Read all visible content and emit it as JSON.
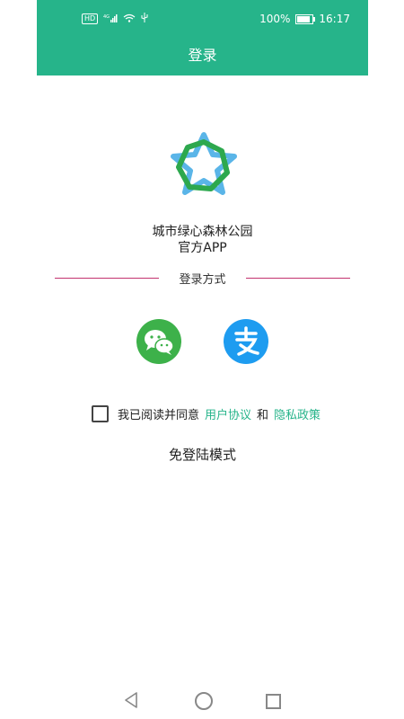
{
  "status_bar": {
    "hd_label": "HD",
    "network": "4G",
    "battery_pct": "100%",
    "time": "16:17"
  },
  "header": {
    "title": "登录",
    "color": "#26b48a"
  },
  "app": {
    "name_line1": "城市绿心森林公园",
    "name_line2": "官方APP"
  },
  "login": {
    "divider_text": "登录方式",
    "methods": [
      "wechat-icon",
      "alipay-icon"
    ]
  },
  "agreement": {
    "prefix": "我已阅读并同意",
    "user_agreement": "用户协议",
    "and": "和",
    "privacy_policy": "隐私政策"
  },
  "guest_mode": "免登陆模式",
  "nav_icons": [
    "back-icon",
    "home-icon",
    "recent-apps-icon"
  ]
}
